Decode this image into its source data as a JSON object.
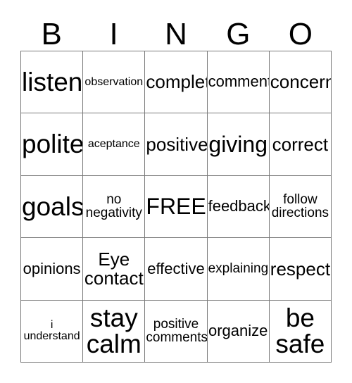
{
  "card": {
    "header_letters": [
      "B",
      "I",
      "N",
      "G",
      "O"
    ],
    "rows": [
      [
        {
          "text": "listen",
          "size": "xl"
        },
        {
          "text": "observation",
          "size": "xxs"
        },
        {
          "text": "complete",
          "size": "md"
        },
        {
          "text": "comments",
          "size": "sm"
        },
        {
          "text": "concern",
          "size": "md"
        }
      ],
      [
        {
          "text": "polite",
          "size": "xl"
        },
        {
          "text": "aceptance",
          "size": "xxs"
        },
        {
          "text": "positive",
          "size": "md"
        },
        {
          "text": "giving",
          "size": "lg"
        },
        {
          "text": "correct",
          "size": "md"
        }
      ],
      [
        {
          "text": "goals",
          "size": "xl"
        },
        {
          "text": "no\nnegativity",
          "size": "xs"
        },
        {
          "text": "FREE!",
          "size": "lg"
        },
        {
          "text": "feedback",
          "size": "sm"
        },
        {
          "text": "follow\ndirections",
          "size": "xs"
        }
      ],
      [
        {
          "text": "opinions",
          "size": "sm"
        },
        {
          "text": "Eye\ncontact",
          "size": "md"
        },
        {
          "text": "effective",
          "size": "sm"
        },
        {
          "text": "explaining",
          "size": "xs"
        },
        {
          "text": "respect",
          "size": "md"
        }
      ],
      [
        {
          "text": "i\nunderstand",
          "size": "xxs"
        },
        {
          "text": "stay\ncalm",
          "size": "xl"
        },
        {
          "text": "positive\ncomments",
          "size": "xs"
        },
        {
          "text": "organize",
          "size": "sm"
        },
        {
          "text": "be\nsafe",
          "size": "xl"
        }
      ]
    ],
    "colors": {
      "background": "#ffffff",
      "text": "#000000",
      "grid_line": "#7a7a7a"
    },
    "free_space": {
      "row": 2,
      "column": 2,
      "label": "FREE!"
    }
  }
}
